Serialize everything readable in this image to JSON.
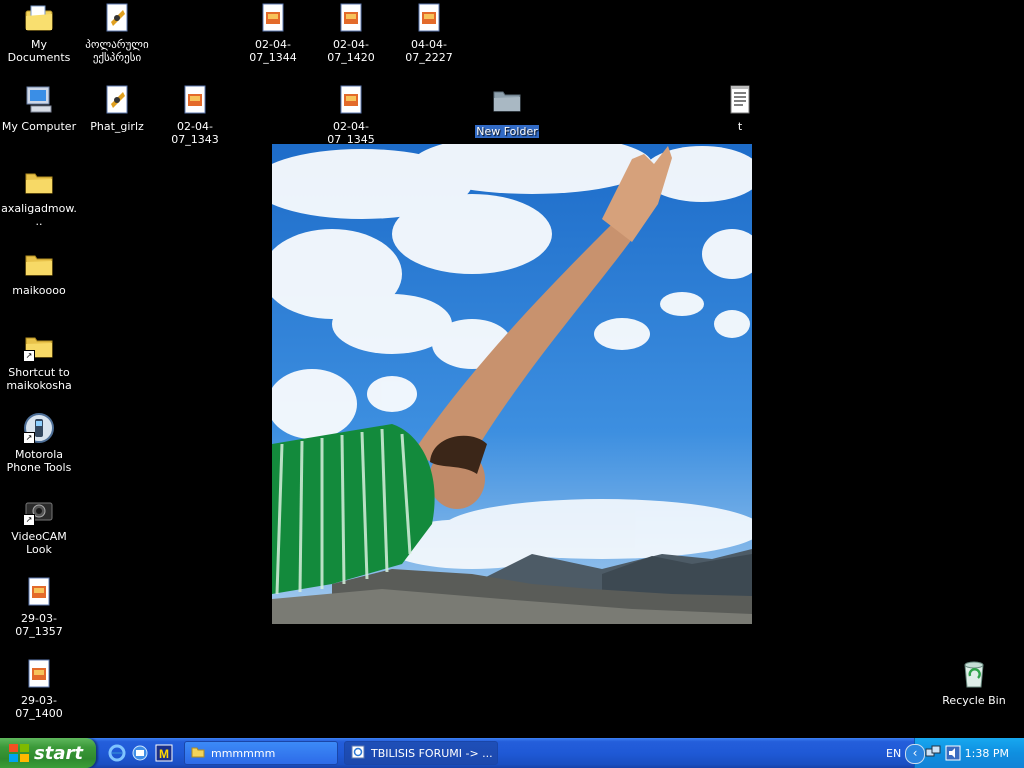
{
  "desktop": {
    "icons": [
      {
        "label": "My Documents",
        "type": "my-documents"
      },
      {
        "label": "პოლარული ექსპრესი",
        "type": "video-file"
      },
      {
        "label": "02-04-07_1344",
        "type": "image-file"
      },
      {
        "label": "02-04-07_1420",
        "type": "image-file"
      },
      {
        "label": "04-04-07_2227",
        "type": "image-file"
      },
      {
        "label": "My Computer",
        "type": "my-computer"
      },
      {
        "label": "Phat_girlz",
        "type": "video-file"
      },
      {
        "label": "02-04-07_1343",
        "type": "image-file"
      },
      {
        "label": "02-04-07_1345",
        "type": "image-file"
      },
      {
        "label": "New Folder",
        "type": "folder-gray",
        "selected": true
      },
      {
        "label": "t",
        "type": "text-file"
      },
      {
        "label": "axaligadmow...",
        "type": "folder"
      },
      {
        "label": "maikoooo",
        "type": "folder"
      },
      {
        "label": "Shortcut to maikokosha",
        "type": "folder-shortcut"
      },
      {
        "label": "Motorola Phone Tools",
        "type": "phone-shortcut"
      },
      {
        "label": "VideoCAM Look",
        "type": "camera-shortcut"
      },
      {
        "label": "29-03-07_1357",
        "type": "image-file"
      },
      {
        "label": "29-03-07_1400",
        "type": "image-file"
      },
      {
        "label": "Recycle Bin",
        "type": "recycle-bin"
      }
    ]
  },
  "taskbar": {
    "start_label": "start",
    "quick_launch": [
      "internet-explorer-icon",
      "outlook-express-icon",
      "gmail-icon"
    ],
    "tasks": [
      {
        "label": "mmmmmm",
        "icon": "folder-icon"
      },
      {
        "label": "TBILISIS FORUMI -> ...",
        "icon": "ie-page-icon"
      }
    ],
    "language": "EN",
    "clock": "1:38 PM"
  },
  "colors": {
    "desktop_bg": "#000000",
    "taskbar_blue": "#245edb",
    "start_green": "#3c9a3a",
    "tray_blue": "#0f8fe0",
    "selection": "#316ac5"
  }
}
